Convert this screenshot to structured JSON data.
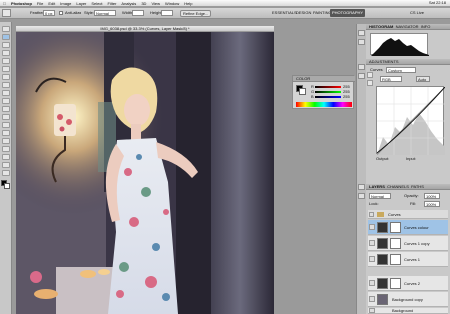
{
  "menubar": {
    "apple_icon": "apple-icon",
    "items": [
      "Photoshop",
      "File",
      "Edit",
      "Image",
      "Layer",
      "Select",
      "Filter",
      "Analysis",
      "3D",
      "View",
      "Window",
      "Help"
    ],
    "clock": "Sat 22:18"
  },
  "optbar": {
    "feather_label": "Feather:",
    "feather_value": "0 px",
    "antialias_label": "Anti-alias",
    "style_label": "Style:",
    "style_value": "Normal",
    "width_label": "Width:",
    "height_label": "Height:",
    "refine_label": "Refine Edge...",
    "workspaces": [
      "ESSENTIALS",
      "DESIGN",
      "PAINTING",
      "PHOTOGRAPHY"
    ],
    "active_workspace": "PHOTOGRAPHY",
    "cs_live": "CS Live"
  },
  "document": {
    "title": "IMG_6038.psd @ 33.3% (Curves, Layer Mask/8) *"
  },
  "color_panel": {
    "title": "COLOR",
    "r_label": "R",
    "g_label": "G",
    "b_label": "B",
    "r_value": "255",
    "g_value": "255",
    "b_value": "255"
  },
  "histogram_panel": {
    "title": "HISTOGRAM",
    "tabs": [
      "HISTOGRAM",
      "NAVIGATOR",
      "INFO"
    ]
  },
  "adjustments_panel": {
    "title": "ADJUSTMENTS",
    "mode_label": "Curves",
    "preset_value": "Custom",
    "channel_value": "RGB",
    "auto_label": "Auto",
    "output_label": "Output:",
    "input_label": "Input:"
  },
  "layers_panel": {
    "title": "LAYERS",
    "tabs": [
      "LAYERS",
      "CHANNELS",
      "PATHS"
    ],
    "blend_mode": "Normal",
    "opacity_label": "Opacity:",
    "opacity_value": "100%",
    "fill_label": "Fill:",
    "fill_value": "100%",
    "lock_label": "Lock:",
    "group_name": "Curves",
    "layers": [
      {
        "name": "Curves colour",
        "selected": true
      },
      {
        "name": "Curves 1 copy",
        "selected": false
      },
      {
        "name": "Curves 1",
        "selected": false
      },
      {
        "name": "Curves 2",
        "selected": false
      },
      {
        "name": "Background copy",
        "selected": false
      },
      {
        "name": "Background",
        "selected": false
      }
    ]
  },
  "colors": {
    "selection_blue": "#9fc3e6",
    "panel_gray": "#c9c9c9",
    "canvas_gray": "#9a9a9a"
  }
}
